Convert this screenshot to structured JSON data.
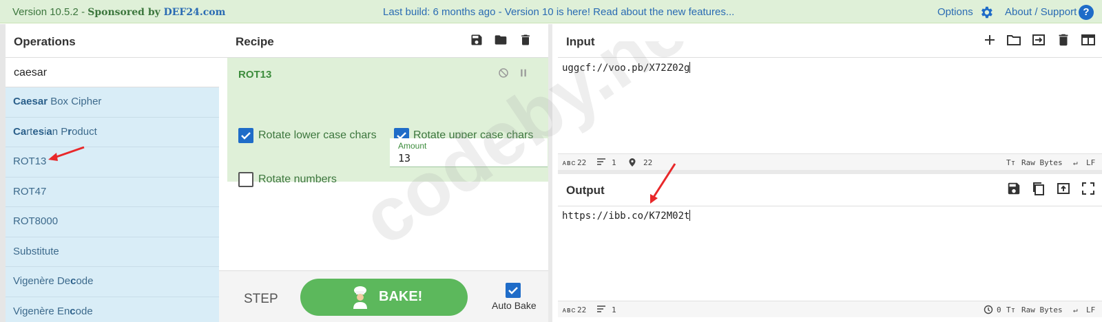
{
  "banner": {
    "version": "Version 10.5.2 - ",
    "sponsored": "Sponsored by ",
    "sponsor_link": "DEF24.com",
    "news": "Last build: 6 months ago - Version 10 is here! Read about the new features...",
    "options": "Options",
    "about": "About / Support",
    "help": "?"
  },
  "operations": {
    "title": "Operations",
    "search_value": "caesar",
    "items": [
      {
        "bold": "Caesar",
        "rest": " Box Cipher"
      },
      {
        "html": "<b>Ca</b>rt<b>es</b>i<b>a</b>n P<b>r</b>oduct"
      },
      {
        "rest": "ROT13"
      },
      {
        "rest": "ROT47"
      },
      {
        "rest": "ROT8000"
      },
      {
        "rest": "Substitute"
      },
      {
        "html": "Vigenère De<b>c</b>ode"
      },
      {
        "html": "Vigenère En<b>c</b>ode"
      }
    ]
  },
  "recipe": {
    "title": "Recipe",
    "op_name": "ROT13",
    "rotate_lower": "Rotate lower case chars",
    "rotate_upper": "Rotate upper case chars",
    "rotate_numbers": "Rotate numbers",
    "amount_label": "Amount",
    "amount_value": "13",
    "step": "STEP",
    "bake": "BAKE!",
    "auto_bake": "Auto Bake"
  },
  "input": {
    "title": "Input",
    "text": "uggcf://voo.pb/X72Z02g",
    "status": {
      "abc": "22",
      "lines": "1",
      "pos": "22",
      "encoding": "Raw Bytes",
      "eol": "LF"
    }
  },
  "output": {
    "title": "Output",
    "text": "https://ibb.co/K72M02t",
    "status": {
      "abc": "22",
      "lines": "1",
      "time": "0",
      "encoding": "Raw Bytes",
      "eol": "LF"
    }
  },
  "watermark": "codeby.net",
  "colors": {
    "accent_blue": "#1f6cc8",
    "recipe_green": "#dff0d8",
    "bake_green": "#5cb85c",
    "ops_blue": "#d9edf7",
    "arrow_red": "#e8282a"
  }
}
